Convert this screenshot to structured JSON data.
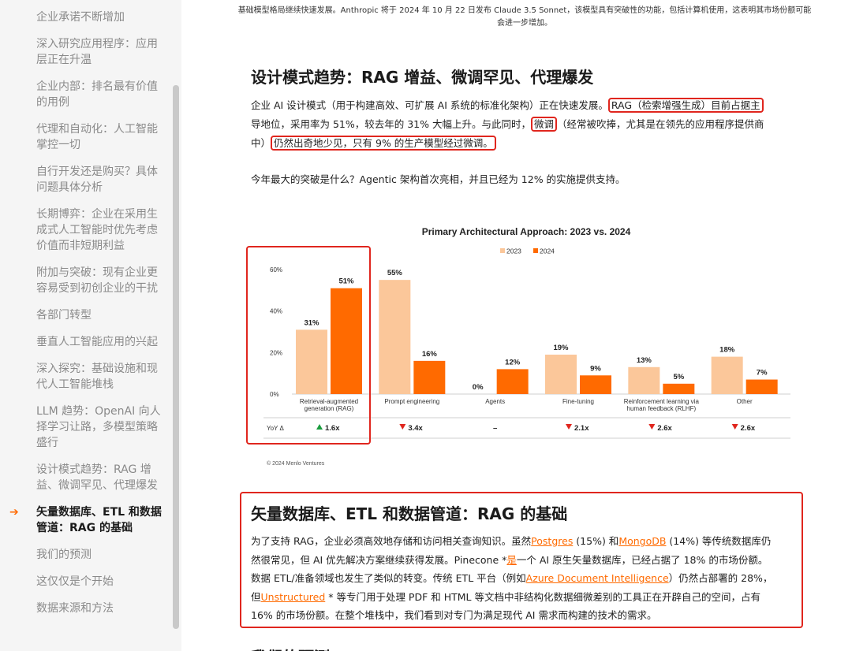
{
  "sidebar": {
    "items": [
      {
        "label": "企业承诺不断增加"
      },
      {
        "label": "深入研究应用程序：应用层正在升温"
      },
      {
        "label": "企业内部：排名最有价值的用例"
      },
      {
        "label": "代理和自动化：人工智能掌控一切"
      },
      {
        "label": "自行开发还是购买？具体问题具体分析"
      },
      {
        "label": "长期博弈：企业在采用生成式人工智能时优先考虑价值而非短期利益"
      },
      {
        "label": "附加与突破：现有企业更容易受到初创企业的干扰"
      },
      {
        "label": "各部门转型"
      },
      {
        "label": "垂直人工智能应用的兴起"
      },
      {
        "label": "深入探究：基础设施和现代人工智能堆栈"
      },
      {
        "label": "LLM 趋势：OpenAI 向人择学习让路，多模型策略盛行"
      },
      {
        "label": "设计模式趋势：RAG 增益、微调罕见、代理爆发"
      },
      {
        "label": "矢量数据库、ETL 和数据管道：RAG 的基础",
        "active": true
      },
      {
        "label": "我们的预测"
      },
      {
        "label": "这仅仅是个开始"
      },
      {
        "label": "数据来源和方法"
      }
    ],
    "active_arrow": "➔"
  },
  "content": {
    "top_caption": "基础模型格局继续快速发展。Anthropic 将于 2024 年 10 月 22 日发布 Claude 3.5 Sonnet，该模型具有突破性的功能，包括计算机使用，这表明其市场份额可能会进一步增加。",
    "section1": {
      "heading": "设计模式趋势：RAG 增益、微调罕见、代理爆发",
      "p1_a": "企业 AI 设计模式（用于构建高效、可扩展 AI 系统的标准化架构）正在快速发展。",
      "p1_hl1": "RAG（检索增强生成）目前占据主",
      "p1_b": "导地位，采用率为 51%，较去年的 31% 大幅上升。与此同时，",
      "p1_hl2": "微调",
      "p1_c": "（经常被吹捧，尤其是在领先的应用程序提供商",
      "p1_d": "中）",
      "p1_hl3": "仍然出奇地少见，只有 9% 的生产模型经过微调。",
      "p2": "今年最大的突破是什么？Agentic 架构首次亮相，并且已经为 12% 的实施提供支持。"
    },
    "section2": {
      "heading": "矢量数据库、ETL 和数据管道：RAG 的基础",
      "l1_a": "为了支持 RAG，企业必须高效地存储和访问相关查询知识。虽然",
      "l1_link1": "Postgres",
      "l1_b": " (15%) 和",
      "l1_link2": "MongoDB",
      "l1_c": " (14%) 等传统数据库仍",
      "l2_a": "然很常见，但 AI 优先解决方案继续获得发展。Pinecone *",
      "l2_link": "是",
      "l2_b": "一个 AI 原生矢量数据库，已经占据了 18% 的市场份额。",
      "l3_a": "数据 ETL/准备领域也发生了类似的转变。传统 ETL 平台（例如",
      "l3_link": "Azure Document Intelligence",
      "l3_b": "）仍然占部署的 28%，",
      "l4_a": "但",
      "l4_link": "Unstructured",
      "l4_b": " * 等专门用于处理 PDF 和 HTML 等文档中非结构化数据细微差别的工具正在开辟自己的空间，占有",
      "l5": "16% 的市场份额。在整个堆栈中，我们看到对专门为满足现代 AI 需求而构建的技术的需求。"
    },
    "next_heading": "我们的预测"
  },
  "colors": {
    "series_2023": "#fbc79a",
    "series_2024": "#ff6a00",
    "highlight_red": "#e0261e",
    "link_orange": "#ff6a00",
    "yoy_up": "#1a9c3e",
    "yoy_down": "#e0261e"
  },
  "chart_data": {
    "type": "bar",
    "title": "Primary Architectural Approach: 2023 vs. 2024",
    "categories": [
      [
        "Retrieval-augmented",
        "generation (RAG)"
      ],
      [
        "Prompt engineering"
      ],
      [
        "Agents"
      ],
      [
        "Fine-tuning"
      ],
      [
        "Reinforcement learning via",
        "human feedback (RLHF)"
      ],
      [
        "Other"
      ]
    ],
    "series": [
      {
        "name": "2023",
        "values": [
          31,
          55,
          0,
          19,
          13,
          18
        ]
      },
      {
        "name": "2024",
        "values": [
          51,
          16,
          12,
          9,
          5,
          7
        ]
      }
    ],
    "value_labels": [
      [
        "31%",
        "55%",
        "0%",
        "19%",
        "13%",
        "18%"
      ],
      [
        "51%",
        "16%",
        "12%",
        "9%",
        "5%",
        "7%"
      ]
    ],
    "yticks": [
      "0%",
      "20%",
      "40%",
      "60%"
    ],
    "ytick_values": [
      0,
      20,
      40,
      60
    ],
    "ylim": [
      0,
      60
    ],
    "legend_position": "top-center",
    "yoy_label": "YoY Δ",
    "yoy": [
      {
        "dir": "up",
        "text": "1.6x"
      },
      {
        "dir": "down",
        "text": "3.4x"
      },
      {
        "dir": "none",
        "text": "–"
      },
      {
        "dir": "down",
        "text": "2.1x"
      },
      {
        "dir": "down",
        "text": "2.6x"
      },
      {
        "dir": "down",
        "text": "2.6x"
      }
    ],
    "copyright": "© 2024 Menlo Ventures"
  }
}
